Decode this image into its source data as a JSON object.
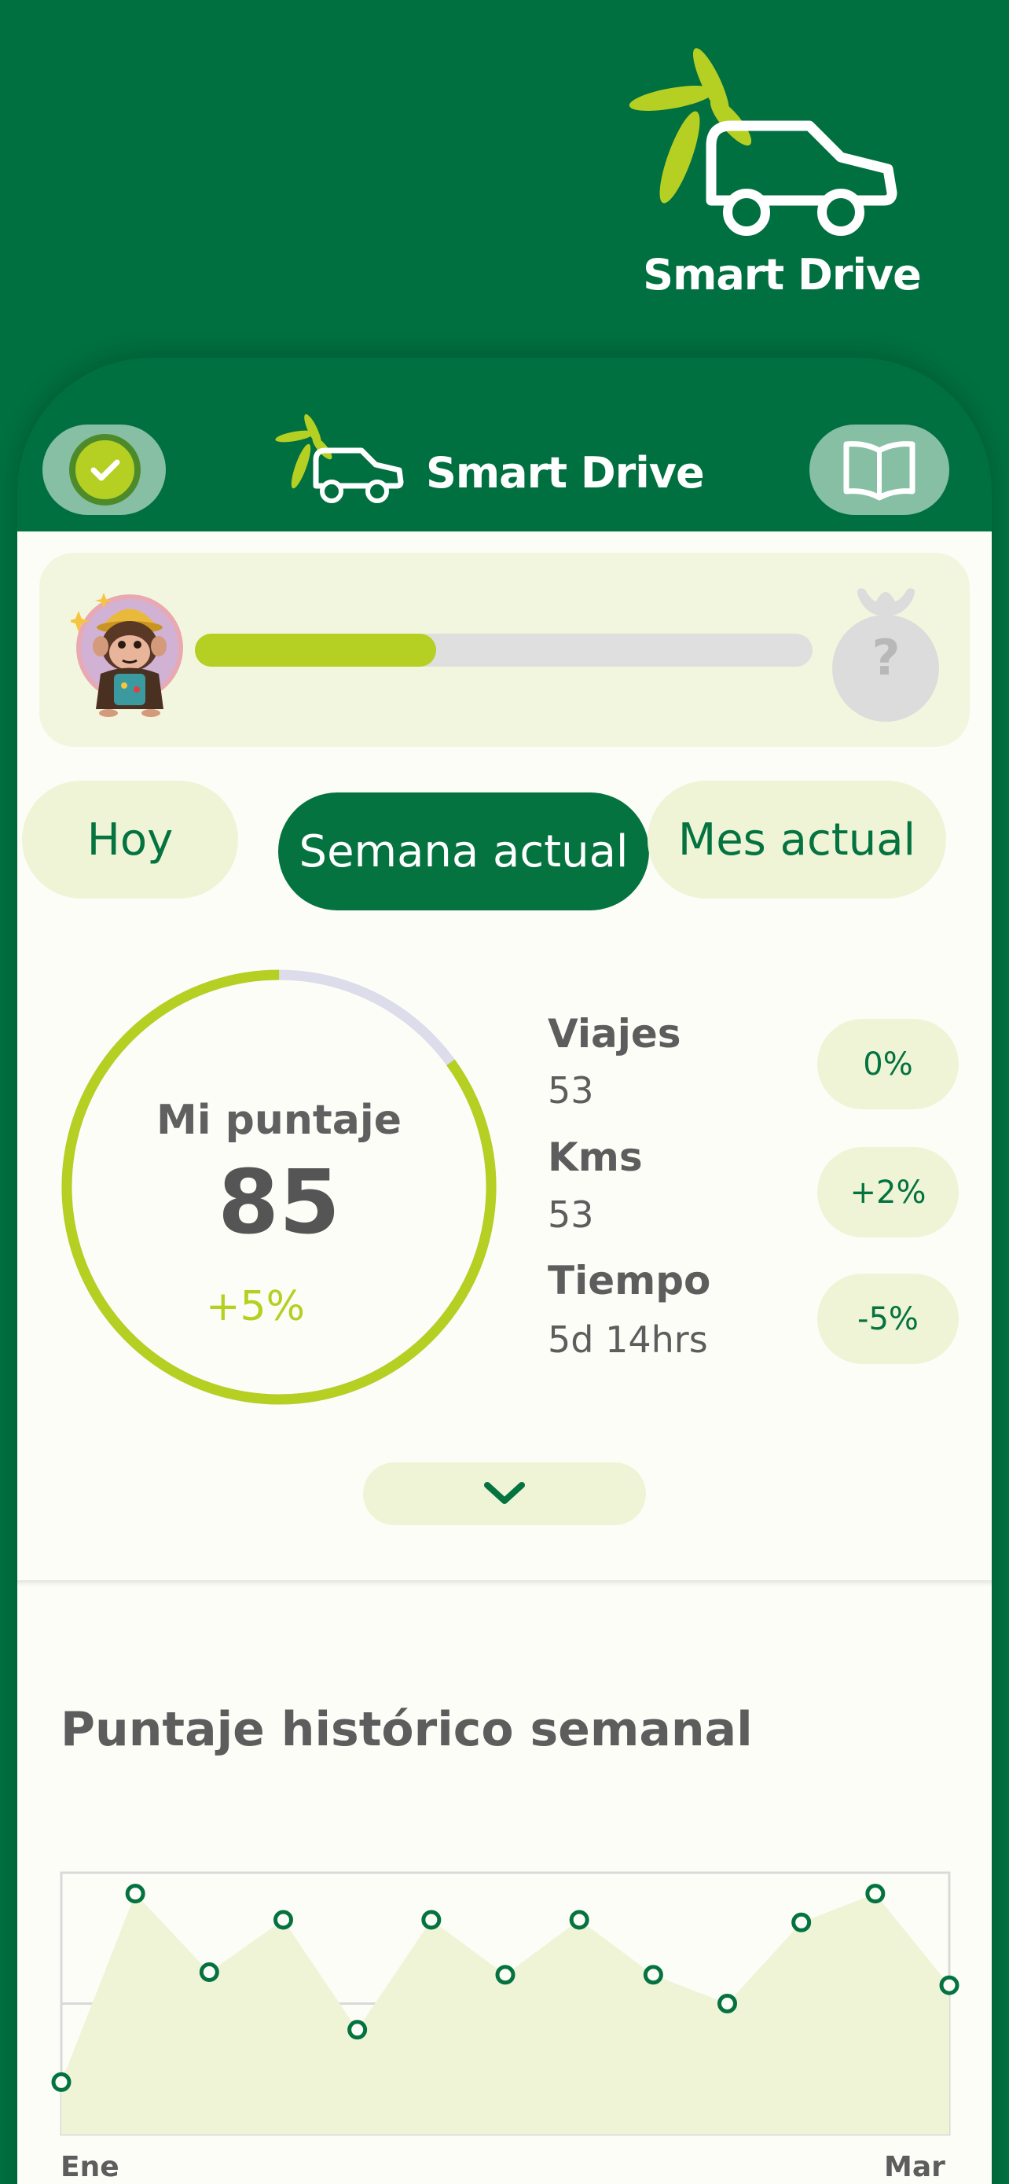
{
  "app": {
    "title": "Smart Drive",
    "brand_green": "#007040",
    "accent_lime": "#b5cf22"
  },
  "header": {
    "title": "Smart Drive",
    "status_icon": "check-circle-icon",
    "guide_icon": "open-book-icon"
  },
  "progress": {
    "level_fraction": 0.39,
    "next_reward": "?"
  },
  "tabs": [
    {
      "label": "Hoy",
      "active": false
    },
    {
      "label": "Semana actual",
      "active": true
    },
    {
      "label": "Mes actual",
      "active": false
    }
  ],
  "score": {
    "label": "Mi puntaje",
    "value": "85",
    "delta": "+5%"
  },
  "stats": [
    {
      "label": "Viajes",
      "value": "53",
      "change": "0%"
    },
    {
      "label": "Kms",
      "value": "53",
      "change": "+2%"
    },
    {
      "label": "Tiempo",
      "value": "5d 14hrs",
      "change": "-5%"
    }
  ],
  "expand_icon": "chevron-down-icon",
  "history": {
    "title": "Puntaje histórico semanal"
  },
  "chart_data": {
    "type": "area",
    "title": "Puntaje histórico semanal",
    "x_start_label": "Ene",
    "x_end_label": "Mar",
    "values": [
      20,
      92,
      62,
      82,
      40,
      82,
      61,
      82,
      61,
      50,
      81,
      92,
      57
    ],
    "ylim": [
      0,
      100
    ],
    "grid": true
  }
}
